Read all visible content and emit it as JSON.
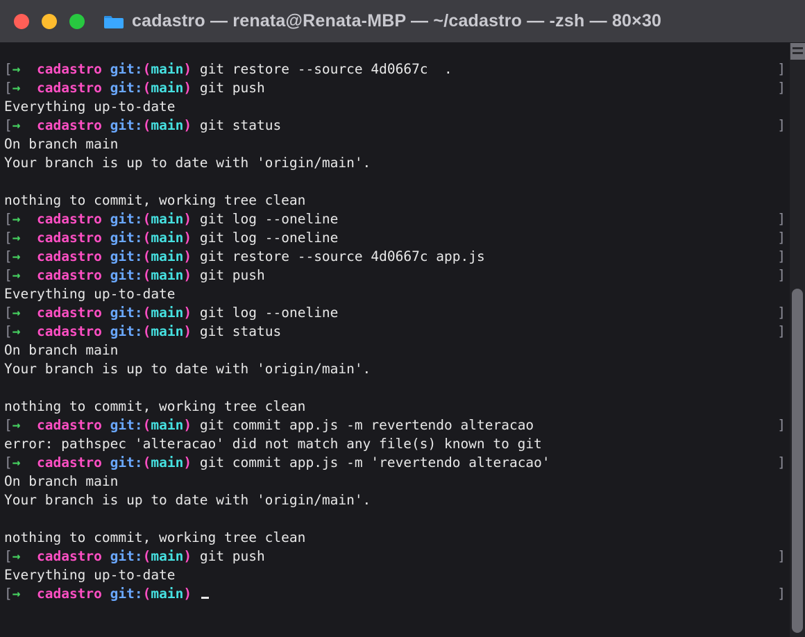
{
  "window": {
    "title": "cadastro — renata@Renata-MBP — ~/cadastro — -zsh — 80×30"
  },
  "prompt_tokens": {
    "lbracket": "[",
    "arrow": "→",
    "dir": "cadastro",
    "git_label": "git:",
    "lparen": "(",
    "branch": "main",
    "rparen": ")"
  },
  "lines": [
    {
      "type": "prompt",
      "cmd": "git restore --source 4d0667c  ."
    },
    {
      "type": "prompt",
      "cmd": "git push"
    },
    {
      "type": "output",
      "text": "Everything up-to-date"
    },
    {
      "type": "prompt",
      "cmd": "git status"
    },
    {
      "type": "output",
      "text": "On branch main"
    },
    {
      "type": "output",
      "text": "Your branch is up to date with 'origin/main'."
    },
    {
      "type": "blank"
    },
    {
      "type": "output",
      "text": "nothing to commit, working tree clean"
    },
    {
      "type": "prompt",
      "cmd": "git log --oneline"
    },
    {
      "type": "prompt",
      "cmd": "git log --oneline"
    },
    {
      "type": "prompt",
      "cmd": "git restore --source 4d0667c app.js"
    },
    {
      "type": "prompt",
      "cmd": "git push"
    },
    {
      "type": "output",
      "text": "Everything up-to-date"
    },
    {
      "type": "prompt",
      "cmd": "git log --oneline"
    },
    {
      "type": "prompt",
      "cmd": "git status"
    },
    {
      "type": "output",
      "text": "On branch main"
    },
    {
      "type": "output",
      "text": "Your branch is up to date with 'origin/main'."
    },
    {
      "type": "blank"
    },
    {
      "type": "output",
      "text": "nothing to commit, working tree clean"
    },
    {
      "type": "prompt",
      "cmd": "git commit app.js -m revertendo alteracao"
    },
    {
      "type": "output",
      "text": "error: pathspec 'alteracao' did not match any file(s) known to git"
    },
    {
      "type": "prompt",
      "cmd": "git commit app.js -m 'revertendo alteracao'"
    },
    {
      "type": "output",
      "text": "On branch main"
    },
    {
      "type": "output",
      "text": "Your branch is up to date with 'origin/main'."
    },
    {
      "type": "blank"
    },
    {
      "type": "output",
      "text": "nothing to commit, working tree clean"
    },
    {
      "type": "prompt",
      "cmd": "git push"
    },
    {
      "type": "output",
      "text": "Everything up-to-date"
    },
    {
      "type": "prompt-cursor",
      "cmd": ""
    }
  ]
}
